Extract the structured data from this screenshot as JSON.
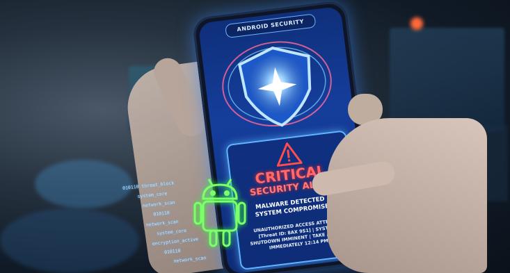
{
  "phone": {
    "header": "ANDROID SECURITY",
    "alert": {
      "title_line1": "CRITICAL",
      "title_line2": "SECURITY ALERT",
      "sub_line1": "MALWARE DETECTED &",
      "sub_line2": "SYSTEM COMPROMISED",
      "detail_line1": "UNAUTHORIZED ACCESS ATTEMPT",
      "detail_line2": "[Threat ID: 8AX 9S1] | SYSTEM",
      "detail_line3": "SHUTDOWN IMMINENT | TAKE ACTION",
      "detail_line4": "IMMEDIATELY 12:14 PM"
    }
  },
  "code_overlay": [
    "010110 threat_block",
    "system_core",
    "network_scan",
    "010110",
    "network_scan",
    "system_core",
    "encryption_active",
    "010110",
    "network_scan"
  ],
  "colors": {
    "screen_blue": "#153e9c",
    "alert_red": "#ff6a6a",
    "glow_cyan": "#5fb6ff",
    "droid_green": "#7cff6a"
  }
}
